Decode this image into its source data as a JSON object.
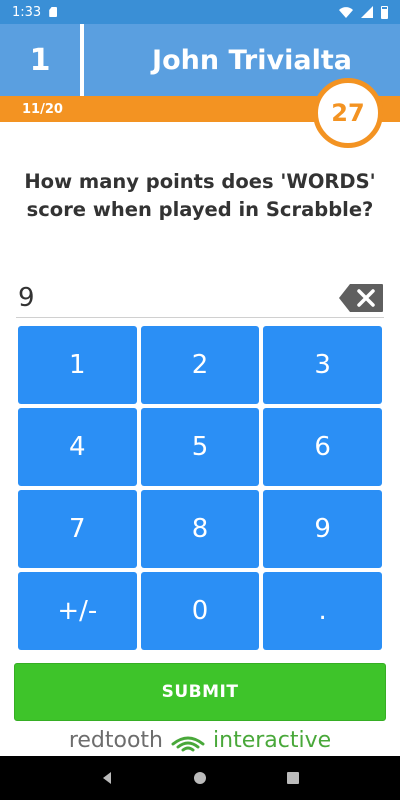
{
  "status_bar": {
    "time": "1:33"
  },
  "header": {
    "rank": "1",
    "player_name": "John Trivialta",
    "progress": "11/20",
    "timer": "27"
  },
  "question": {
    "text": "How many points does 'WORDS' score when played in Scrabble?"
  },
  "answer": {
    "value": "9"
  },
  "keypad": {
    "keys": [
      "1",
      "2",
      "3",
      "4",
      "5",
      "6",
      "7",
      "8",
      "9",
      "+/-",
      "0",
      "."
    ]
  },
  "submit_label": "SUBMIT",
  "brand": {
    "part1": "redtooth",
    "part2": "interactive"
  },
  "colors": {
    "header_blue": "#5a9fe0",
    "orange": "#f39322",
    "key_blue": "#2b8ff5",
    "submit_green": "#3ec42a"
  }
}
